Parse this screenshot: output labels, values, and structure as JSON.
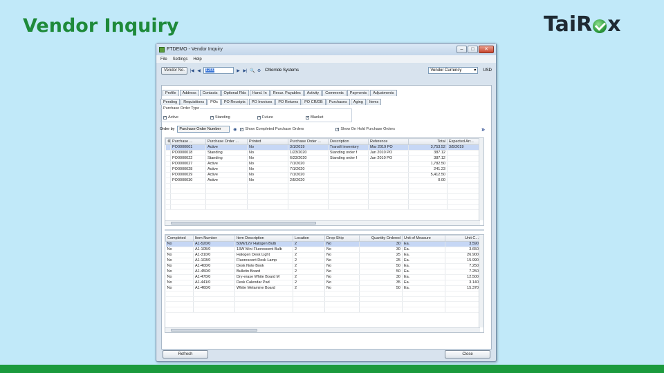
{
  "slide": {
    "title": "Vendor Inquiry",
    "logo_text_left": "Tai",
    "logo_text_r": "R",
    "logo_text_right": "x"
  },
  "window": {
    "title": "FTDEMO - Vendor Inquiry",
    "menu": [
      "File",
      "Settings",
      "Help"
    ],
    "toolbar": {
      "vendor_label": "Vendor No.",
      "vendor_value": "1200",
      "vendor_name": "Chlorride Systems",
      "currency_select": "Vendor Currency",
      "currency_code": "USD"
    },
    "tabs_row1": [
      "Profile",
      "Address",
      "Contacts",
      "Optional Flds",
      "Hand. In",
      "Recur. Payables",
      "Activity",
      "Comments",
      "Payments",
      "Adjustments"
    ],
    "tabs_row2": [
      "Pending",
      "Requisitions",
      "POs",
      "PO Receipts",
      "PO Invoices",
      "PO Returns",
      "PO CR/DB",
      "Purchases",
      "Aging",
      "Items"
    ],
    "filter": {
      "legend": "Purchase Order Type",
      "options": [
        {
          "label": "Active",
          "checked": "✓"
        },
        {
          "label": "Standing",
          "checked": "✓"
        },
        {
          "label": "Future",
          "checked": "✓"
        },
        {
          "label": "Blanket",
          "checked": "✓"
        }
      ]
    },
    "order": {
      "label": "Order by",
      "value": "Purchase Order Number",
      "show_completed": "Show Completed Purchase Orders",
      "show_on_hold": "Show On Hold Purchase Orders",
      "more": "»"
    },
    "po_grid": {
      "columns": [
        "",
        "Purchase ...",
        "Purchase Order ...",
        "Printed",
        "Purchase Order ...",
        "Description",
        "Reference",
        "Total",
        "Expected Arr..."
      ],
      "rows": [
        [
          "PO0000001",
          "Active",
          "No",
          "3/1/2019",
          "Transfil inventory",
          "Mar 2019 PO",
          "3,753.52",
          "3/5/2019"
        ],
        [
          "PO0000018",
          "Standing",
          "No",
          "1/23/2020",
          "Standing order f",
          "Jan 2010 PO",
          "387.12",
          ""
        ],
        [
          "PO0000022",
          "Standing",
          "No",
          "6/23/2020",
          "Standing order f",
          "Jan 2010 PO",
          "387.12",
          ""
        ],
        [
          "PO0000027",
          "Active",
          "No",
          "7/1/2020",
          "",
          "",
          "1,782.50",
          ""
        ],
        [
          "PO0000028",
          "Active",
          "No",
          "7/1/2020",
          "",
          "",
          "241.23",
          ""
        ],
        [
          "PO0000029",
          "Active",
          "No",
          "7/1/2020",
          "",
          "",
          "5,412.50",
          ""
        ],
        [
          "PO0000030",
          "Active",
          "No",
          "2/5/2020",
          "",
          "",
          "0.00",
          ""
        ]
      ]
    },
    "item_grid": {
      "columns": [
        "Completed",
        "Item Number",
        "Item Description",
        "Location",
        "Drop-Ship",
        "Quantity Ordered",
        "Unit of Measure",
        "Unit C..."
      ],
      "rows": [
        [
          "No",
          "A1-520/0",
          "50W/12V Halogen Bulb",
          "2",
          "No",
          "30",
          "Ea.",
          "3.590"
        ],
        [
          "No",
          "A1-105/0",
          "13W Mini Fluorescent Bulb",
          "2",
          "No",
          "30",
          "Ea.",
          "3.650"
        ],
        [
          "No",
          "A1-310/0",
          "Halogen Desk Light",
          "2",
          "No",
          "25",
          "Ea.",
          "26.900"
        ],
        [
          "No",
          "A1-103/0",
          "Fluorescent Desk Lamp",
          "2",
          "No",
          "25",
          "Ea.",
          "15.990"
        ],
        [
          "No",
          "A1-400/0",
          "Desk Note Book",
          "2",
          "No",
          "50",
          "Ea.",
          "7.250"
        ],
        [
          "No",
          "A1-450/0",
          "Bulletin Board",
          "2",
          "No",
          "50",
          "Ea.",
          "7.250"
        ],
        [
          "No",
          "A1-470/0",
          "Dry-erase White Board M",
          "2",
          "No",
          "30",
          "Ea.",
          "12.500"
        ],
        [
          "No",
          "A1-441/0",
          "Desk Calendar Pad",
          "2",
          "No",
          "35",
          "Ea.",
          "3.140"
        ],
        [
          "No",
          "A1-460/0",
          "White Melamine Board",
          "2",
          "No",
          "50",
          "Ea.",
          "15.370"
        ]
      ]
    },
    "buttons": {
      "refresh": "Refresh",
      "close": "Close"
    }
  }
}
